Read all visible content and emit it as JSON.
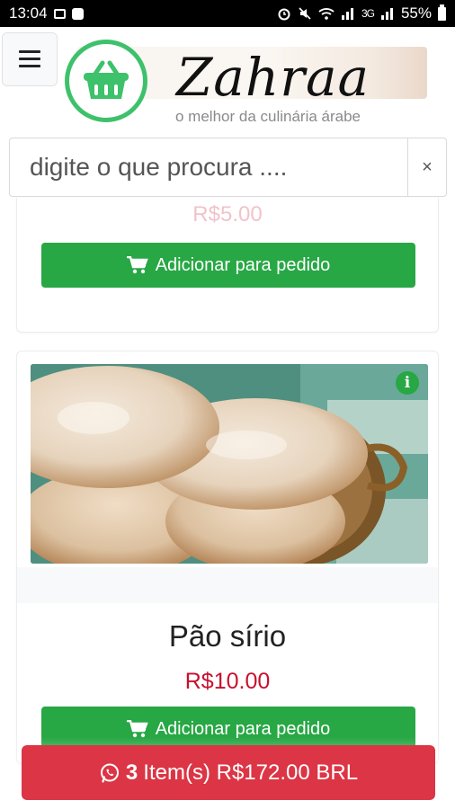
{
  "status_bar": {
    "time": "13:04",
    "signal_text": "3G",
    "battery": "55%"
  },
  "header": {
    "brand": "Zahraa",
    "tagline": "o melhor da culinária árabe",
    "icons": {
      "menu": "hamburger-icon",
      "logo": "basket-icon"
    }
  },
  "search": {
    "placeholder": "digite o que procura ....",
    "value": "",
    "clear_label": "×"
  },
  "products": [
    {
      "price": "R$5.00",
      "add_label": "Adicionar para pedido"
    },
    {
      "name": "Pão sírio",
      "price": "R$10.00",
      "add_label": "Adicionar para pedido",
      "info_label": "i",
      "image": "pita-bread"
    }
  ],
  "cart": {
    "count": "3",
    "summary": "Item(s) R$172.00 BRL",
    "icon": "whatsapp-icon"
  },
  "colors": {
    "green": "#28a745",
    "logo_green": "#3ec16b",
    "red": "#dc3545",
    "price_red": "#c8102e"
  }
}
